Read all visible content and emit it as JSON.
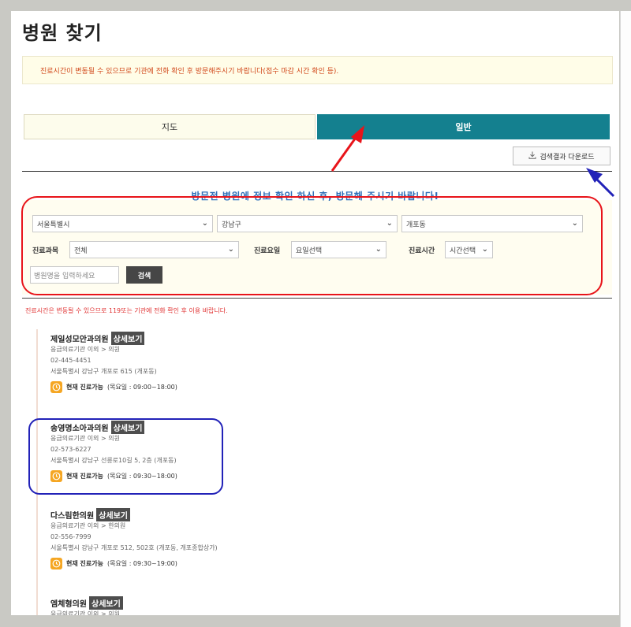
{
  "page": {
    "title": "병원 찾기",
    "notice": "진료시간이 변동될 수 있으므로 기관에 전화 확인 후 방문해주시기 바랍니다(접수 마감 시간 확인 등)."
  },
  "tabs": [
    {
      "label": "지도",
      "active": false
    },
    {
      "label": "일반",
      "active": true
    }
  ],
  "download_button": {
    "label": "검색결과 다운로드",
    "icon": "download-icon"
  },
  "heading": "방문전 병원에 정보 확인 하신 후, 방문해 주시기 바랍니다!",
  "filters": {
    "region1": "서울특별시",
    "region2": "강남구",
    "region3": "개포동",
    "department_label": "진료과목",
    "department_value": "전체",
    "day_label": "진료요일",
    "day_value": "요일선택",
    "time_label": "진료시간",
    "time_value": "시간선택",
    "name_placeholder": "병원명을 입력하세요",
    "search_label": "검색"
  },
  "results_notice": "진료시간은 변동될 수 있으므로 119또는 기관에 전화 확인 후 이용 바랍니다.",
  "detail_label": "상세보기",
  "hospitals": [
    {
      "name": "제일성모안과의원",
      "type": "응급의료기관 이외 > 의원",
      "phone": "02-445-4451",
      "address": "서울특별시 강남구 개포로 615 (개포동)",
      "status": "현재 진료가능",
      "hours": "(목요일 : 09:00~18:00)"
    },
    {
      "name": "송영명소아과의원",
      "type": "응급의료기관 이외 > 의원",
      "phone": "02-573-6227",
      "address": "서울특별시 강남구 선릉로10길 5, 2층 (개포동)",
      "status": "현재 진료가능",
      "hours": "(목요일 : 09:30~18:00)"
    },
    {
      "name": "다스림한의원",
      "type": "응급의료기관 이외 > 한의원",
      "phone": "02-556-7999",
      "address": "서울특별시 강남구 개포로 512, 502호 (개포동, 개포종합상가)",
      "status": "현재 진료가능",
      "hours": "(목요일 : 09:30~19:00)"
    },
    {
      "name": "엠체형의원",
      "type": "응급의료기관 이외 > 의원"
    }
  ],
  "colors": {
    "accent_teal": "#14808f",
    "notice_red": "#d24a1d",
    "heading_blue": "#2f6fb8",
    "annotation_red": "#e8141a",
    "annotation_blue": "#2222b8",
    "clock_orange": "#f5a623"
  }
}
